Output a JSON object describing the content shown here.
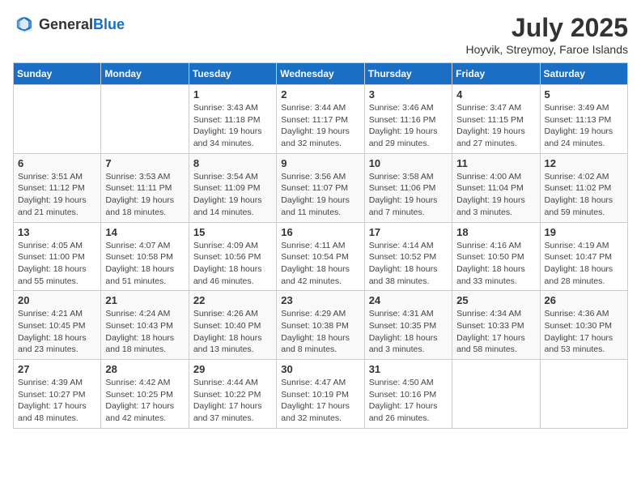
{
  "header": {
    "logo_general": "General",
    "logo_blue": "Blue",
    "month_title": "July 2025",
    "location": "Hoyvik, Streymoy, Faroe Islands"
  },
  "days_of_week": [
    "Sunday",
    "Monday",
    "Tuesday",
    "Wednesday",
    "Thursday",
    "Friday",
    "Saturday"
  ],
  "weeks": [
    [
      {
        "day": "",
        "info": ""
      },
      {
        "day": "",
        "info": ""
      },
      {
        "day": "1",
        "info": "Sunrise: 3:43 AM\nSunset: 11:18 PM\nDaylight: 19 hours and 34 minutes."
      },
      {
        "day": "2",
        "info": "Sunrise: 3:44 AM\nSunset: 11:17 PM\nDaylight: 19 hours and 32 minutes."
      },
      {
        "day": "3",
        "info": "Sunrise: 3:46 AM\nSunset: 11:16 PM\nDaylight: 19 hours and 29 minutes."
      },
      {
        "day": "4",
        "info": "Sunrise: 3:47 AM\nSunset: 11:15 PM\nDaylight: 19 hours and 27 minutes."
      },
      {
        "day": "5",
        "info": "Sunrise: 3:49 AM\nSunset: 11:13 PM\nDaylight: 19 hours and 24 minutes."
      }
    ],
    [
      {
        "day": "6",
        "info": "Sunrise: 3:51 AM\nSunset: 11:12 PM\nDaylight: 19 hours and 21 minutes."
      },
      {
        "day": "7",
        "info": "Sunrise: 3:53 AM\nSunset: 11:11 PM\nDaylight: 19 hours and 18 minutes."
      },
      {
        "day": "8",
        "info": "Sunrise: 3:54 AM\nSunset: 11:09 PM\nDaylight: 19 hours and 14 minutes."
      },
      {
        "day": "9",
        "info": "Sunrise: 3:56 AM\nSunset: 11:07 PM\nDaylight: 19 hours and 11 minutes."
      },
      {
        "day": "10",
        "info": "Sunrise: 3:58 AM\nSunset: 11:06 PM\nDaylight: 19 hours and 7 minutes."
      },
      {
        "day": "11",
        "info": "Sunrise: 4:00 AM\nSunset: 11:04 PM\nDaylight: 19 hours and 3 minutes."
      },
      {
        "day": "12",
        "info": "Sunrise: 4:02 AM\nSunset: 11:02 PM\nDaylight: 18 hours and 59 minutes."
      }
    ],
    [
      {
        "day": "13",
        "info": "Sunrise: 4:05 AM\nSunset: 11:00 PM\nDaylight: 18 hours and 55 minutes."
      },
      {
        "day": "14",
        "info": "Sunrise: 4:07 AM\nSunset: 10:58 PM\nDaylight: 18 hours and 51 minutes."
      },
      {
        "day": "15",
        "info": "Sunrise: 4:09 AM\nSunset: 10:56 PM\nDaylight: 18 hours and 46 minutes."
      },
      {
        "day": "16",
        "info": "Sunrise: 4:11 AM\nSunset: 10:54 PM\nDaylight: 18 hours and 42 minutes."
      },
      {
        "day": "17",
        "info": "Sunrise: 4:14 AM\nSunset: 10:52 PM\nDaylight: 18 hours and 38 minutes."
      },
      {
        "day": "18",
        "info": "Sunrise: 4:16 AM\nSunset: 10:50 PM\nDaylight: 18 hours and 33 minutes."
      },
      {
        "day": "19",
        "info": "Sunrise: 4:19 AM\nSunset: 10:47 PM\nDaylight: 18 hours and 28 minutes."
      }
    ],
    [
      {
        "day": "20",
        "info": "Sunrise: 4:21 AM\nSunset: 10:45 PM\nDaylight: 18 hours and 23 minutes."
      },
      {
        "day": "21",
        "info": "Sunrise: 4:24 AM\nSunset: 10:43 PM\nDaylight: 18 hours and 18 minutes."
      },
      {
        "day": "22",
        "info": "Sunrise: 4:26 AM\nSunset: 10:40 PM\nDaylight: 18 hours and 13 minutes."
      },
      {
        "day": "23",
        "info": "Sunrise: 4:29 AM\nSunset: 10:38 PM\nDaylight: 18 hours and 8 minutes."
      },
      {
        "day": "24",
        "info": "Sunrise: 4:31 AM\nSunset: 10:35 PM\nDaylight: 18 hours and 3 minutes."
      },
      {
        "day": "25",
        "info": "Sunrise: 4:34 AM\nSunset: 10:33 PM\nDaylight: 17 hours and 58 minutes."
      },
      {
        "day": "26",
        "info": "Sunrise: 4:36 AM\nSunset: 10:30 PM\nDaylight: 17 hours and 53 minutes."
      }
    ],
    [
      {
        "day": "27",
        "info": "Sunrise: 4:39 AM\nSunset: 10:27 PM\nDaylight: 17 hours and 48 minutes."
      },
      {
        "day": "28",
        "info": "Sunrise: 4:42 AM\nSunset: 10:25 PM\nDaylight: 17 hours and 42 minutes."
      },
      {
        "day": "29",
        "info": "Sunrise: 4:44 AM\nSunset: 10:22 PM\nDaylight: 17 hours and 37 minutes."
      },
      {
        "day": "30",
        "info": "Sunrise: 4:47 AM\nSunset: 10:19 PM\nDaylight: 17 hours and 32 minutes."
      },
      {
        "day": "31",
        "info": "Sunrise: 4:50 AM\nSunset: 10:16 PM\nDaylight: 17 hours and 26 minutes."
      },
      {
        "day": "",
        "info": ""
      },
      {
        "day": "",
        "info": ""
      }
    ]
  ]
}
